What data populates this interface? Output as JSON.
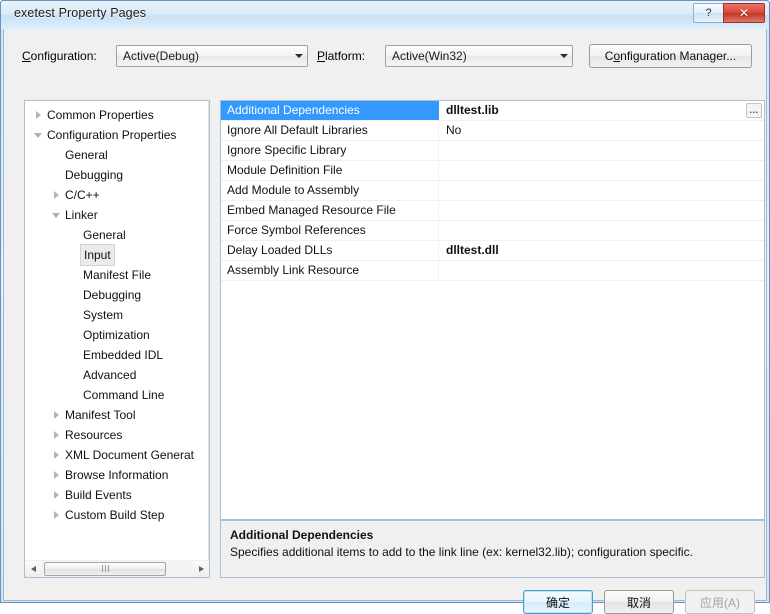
{
  "window": {
    "title": "exetest Property Pages",
    "help_button": "?",
    "close_button": "✕"
  },
  "toolbar": {
    "configuration_label": "Configuration:",
    "configuration_value": "Active(Debug)",
    "platform_label": "Platform:",
    "platform_value": "Active(Win32)",
    "config_manager_label": "Configuration Manager..."
  },
  "tree": {
    "nodes": [
      {
        "label": "Common Properties",
        "indent": 0,
        "expander": "collapsed",
        "selected": false
      },
      {
        "label": "Configuration Properties",
        "indent": 0,
        "expander": "expanded",
        "selected": false
      },
      {
        "label": "General",
        "indent": 1,
        "expander": "none",
        "selected": false
      },
      {
        "label": "Debugging",
        "indent": 1,
        "expander": "none",
        "selected": false
      },
      {
        "label": "C/C++",
        "indent": 1,
        "expander": "collapsed",
        "selected": false
      },
      {
        "label": "Linker",
        "indent": 1,
        "expander": "expanded",
        "selected": false
      },
      {
        "label": "General",
        "indent": 2,
        "expander": "none",
        "selected": false
      },
      {
        "label": "Input",
        "indent": 2,
        "expander": "none",
        "selected": true
      },
      {
        "label": "Manifest File",
        "indent": 2,
        "expander": "none",
        "selected": false
      },
      {
        "label": "Debugging",
        "indent": 2,
        "expander": "none",
        "selected": false
      },
      {
        "label": "System",
        "indent": 2,
        "expander": "none",
        "selected": false
      },
      {
        "label": "Optimization",
        "indent": 2,
        "expander": "none",
        "selected": false
      },
      {
        "label": "Embedded IDL",
        "indent": 2,
        "expander": "none",
        "selected": false
      },
      {
        "label": "Advanced",
        "indent": 2,
        "expander": "none",
        "selected": false
      },
      {
        "label": "Command Line",
        "indent": 2,
        "expander": "none",
        "selected": false
      },
      {
        "label": "Manifest Tool",
        "indent": 1,
        "expander": "collapsed",
        "selected": false
      },
      {
        "label": "Resources",
        "indent": 1,
        "expander": "collapsed",
        "selected": false
      },
      {
        "label": "XML Document Generat",
        "indent": 1,
        "expander": "collapsed",
        "selected": false
      },
      {
        "label": "Browse Information",
        "indent": 1,
        "expander": "collapsed",
        "selected": false
      },
      {
        "label": "Build Events",
        "indent": 1,
        "expander": "collapsed",
        "selected": false
      },
      {
        "label": "Custom Build Step",
        "indent": 1,
        "expander": "collapsed",
        "selected": false
      }
    ],
    "hscroll": {
      "left_arrow": "◀",
      "right_arrow": "▶"
    }
  },
  "grid": {
    "rows": [
      {
        "name": "Additional Dependencies",
        "value": "dlltest.lib",
        "bold": true,
        "selected": true,
        "has_browse": true,
        "browse_label": "..."
      },
      {
        "name": "Ignore All Default Libraries",
        "value": "No",
        "bold": false,
        "selected": false,
        "has_browse": false,
        "browse_label": ""
      },
      {
        "name": "Ignore Specific Library",
        "value": "",
        "bold": false,
        "selected": false,
        "has_browse": false,
        "browse_label": ""
      },
      {
        "name": "Module Definition File",
        "value": "",
        "bold": false,
        "selected": false,
        "has_browse": false,
        "browse_label": ""
      },
      {
        "name": "Add Module to Assembly",
        "value": "",
        "bold": false,
        "selected": false,
        "has_browse": false,
        "browse_label": ""
      },
      {
        "name": "Embed Managed Resource File",
        "value": "",
        "bold": false,
        "selected": false,
        "has_browse": false,
        "browse_label": ""
      },
      {
        "name": "Force Symbol References",
        "value": "",
        "bold": false,
        "selected": false,
        "has_browse": false,
        "browse_label": ""
      },
      {
        "name": "Delay Loaded DLLs",
        "value": "dlltest.dll",
        "bold": true,
        "selected": false,
        "has_browse": false,
        "browse_label": ""
      },
      {
        "name": "Assembly Link Resource",
        "value": "",
        "bold": false,
        "selected": false,
        "has_browse": false,
        "browse_label": ""
      }
    ]
  },
  "description": {
    "title": "Additional Dependencies",
    "body": "Specifies additional items to add to the link line (ex: kernel32.lib); configuration specific."
  },
  "footer": {
    "ok_label": "确定",
    "cancel_label": "取消",
    "apply_label": "应用(A)"
  },
  "colors": {
    "selection_blue": "#3399ff",
    "title_gradient_top": "#e9f2fb",
    "close_red": "#d9483a",
    "dialog_bg": "#f0f0f0"
  }
}
